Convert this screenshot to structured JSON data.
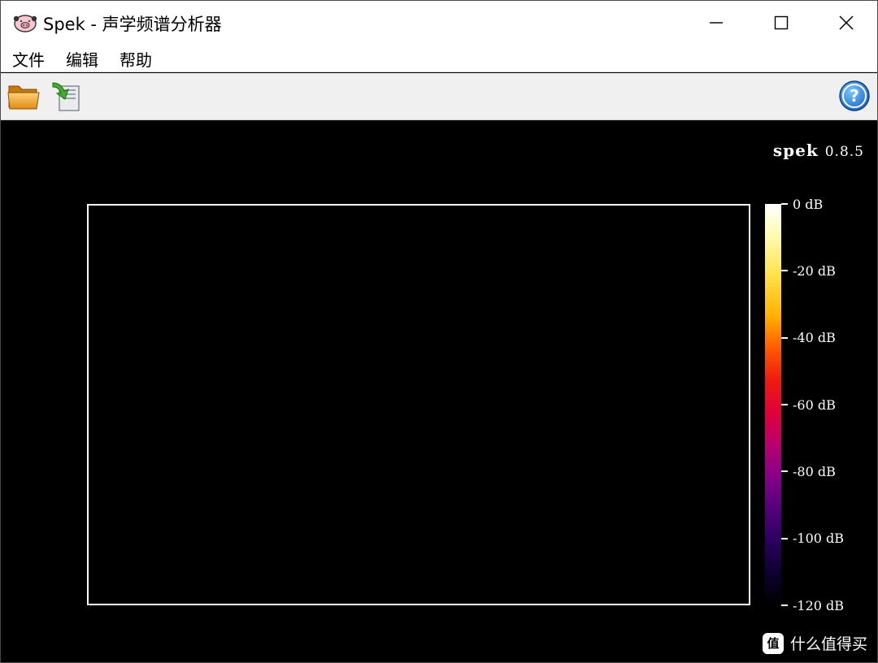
{
  "window": {
    "title": "Spek - 声学频谱分析器",
    "app_icon": "pig-face-icon",
    "controls": {
      "minimize_icon": "minimize-icon",
      "maximize_icon": "maximize-icon",
      "close_icon": "close-icon"
    }
  },
  "menu": {
    "items": [
      {
        "label": "文件"
      },
      {
        "label": "编辑"
      },
      {
        "label": "帮助"
      }
    ]
  },
  "toolbar": {
    "buttons": [
      {
        "icon": "open-folder-icon"
      },
      {
        "icon": "save-export-icon"
      }
    ],
    "help_icon": "help-icon"
  },
  "spectrum": {
    "app_name": "spek",
    "version": "0.8.5",
    "colors": {
      "background": "#000000",
      "frame": "#ffffff"
    },
    "scale": {
      "unit": "dB",
      "ticks": [
        {
          "label": "0 dB",
          "value": 0
        },
        {
          "label": "-20 dB",
          "value": -20
        },
        {
          "label": "-40 dB",
          "value": -40
        },
        {
          "label": "-60 dB",
          "value": -60
        },
        {
          "label": "-80 dB",
          "value": -80
        },
        {
          "label": "-100 dB",
          "value": -100
        },
        {
          "label": "-120 dB",
          "value": -120
        }
      ],
      "range": [
        -120,
        0
      ]
    }
  },
  "watermark": {
    "text": "什么值得买",
    "icon_glyph": "值"
  }
}
